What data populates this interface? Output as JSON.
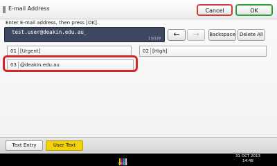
{
  "window": {
    "title": "E-mail Address"
  },
  "header": {
    "cancel_label": "Cancel",
    "ok_label": "OK"
  },
  "instruction": "Enter E-mail address, then press [OK].",
  "entry": {
    "value": "test.user@deakin.edu.au_",
    "counter": "23/128"
  },
  "controls": {
    "left_arrow": "←",
    "right_arrow": "→",
    "backspace_label": "Backspace",
    "delete_all_label": "Delete All"
  },
  "user_text_list": [
    {
      "number": "01",
      "text": "[Urgent]"
    },
    {
      "number": "02",
      "text": "[High]"
    },
    {
      "number": "03",
      "text": "@deakin.edu.au"
    }
  ],
  "tabs": [
    {
      "label": "Text Entry",
      "active": false
    },
    {
      "label": "User Text",
      "active": true
    }
  ],
  "status": {
    "logo_text": "YMCK",
    "date": "31 OCT  2013",
    "time": "14:48"
  },
  "colors": {
    "cancel_border": "#d23a3a",
    "ok_border": "#2f9e3a",
    "active_tab": "#f2d20c",
    "entry_bg": "#3d4860",
    "highlight": "#d42626"
  }
}
